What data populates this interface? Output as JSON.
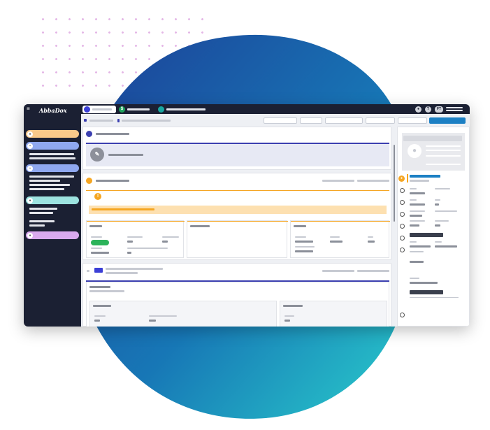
{
  "app": {
    "logo_text": "AbbaDox",
    "user_initials": "FT",
    "notification_icon": "chat-bubble-icon",
    "help_label": "?"
  },
  "tabs": [
    {
      "icon": "patient-icon",
      "color": "#3b3fd6",
      "active": true
    },
    {
      "icon": "dollar-icon",
      "label_icon_text": "$",
      "color": "#1ea35c",
      "active": false
    },
    {
      "icon": "search-icon",
      "color": "#19a7a0",
      "active": false
    }
  ],
  "sidebar": {
    "items": [
      {
        "icon": "user-icon",
        "color": "#f9c98a"
      },
      {
        "icon": "document-icon",
        "color": "#8fa8f0"
      },
      {
        "icon": "document-icon",
        "color": "#8fa8f0"
      },
      {
        "icon": "person-icon",
        "color": "#9de3e0"
      },
      {
        "icon": "chat-icon",
        "color": "#d9a9ee"
      }
    ]
  },
  "colors": {
    "accent_blue": "#3b3fb0",
    "accent_orange": "#f5a623",
    "status_green": "#2cb35a",
    "blob_start": "#1d3f97",
    "blob_end": "#2ad0cc"
  },
  "alert": {
    "icon": "exclamation-icon",
    "glyph": "!"
  }
}
